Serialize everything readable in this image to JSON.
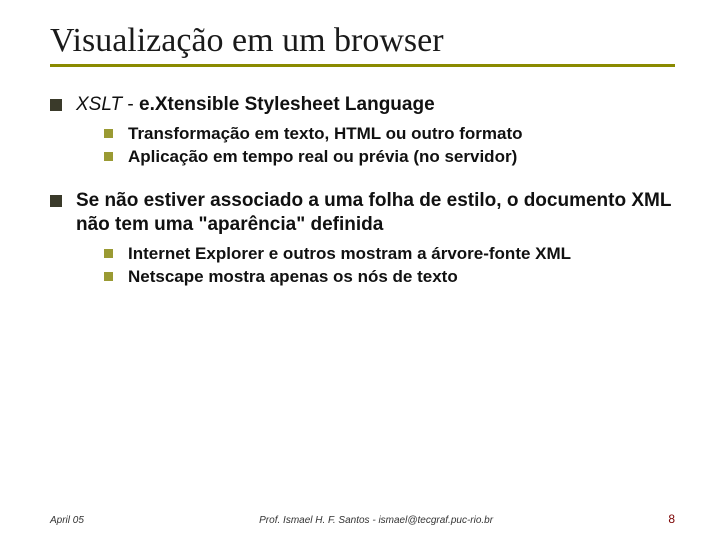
{
  "title": "Visualização em um browser",
  "bullets": [
    {
      "lead_italic": "XSLT",
      "lead_plain": " - ",
      "lead_bold": "e.Xtensible Stylesheet Language",
      "sub": [
        "Transformação em texto, HTML ou outro formato",
        "Aplicação em tempo real ou prévia (no servidor)"
      ]
    },
    {
      "lead_bold_full": "Se não estiver associado a uma folha de estilo, o documento XML não tem uma \"aparência\" definida",
      "sub": [
        "Internet Explorer e outros mostram a árvore-fonte XML",
        "Netscape mostra apenas os nós de texto"
      ]
    }
  ],
  "footer": {
    "date": "April 05",
    "author": "Prof. Ismael H. F. Santos - ismael@tecgraf.puc-rio.br",
    "page": "8"
  }
}
